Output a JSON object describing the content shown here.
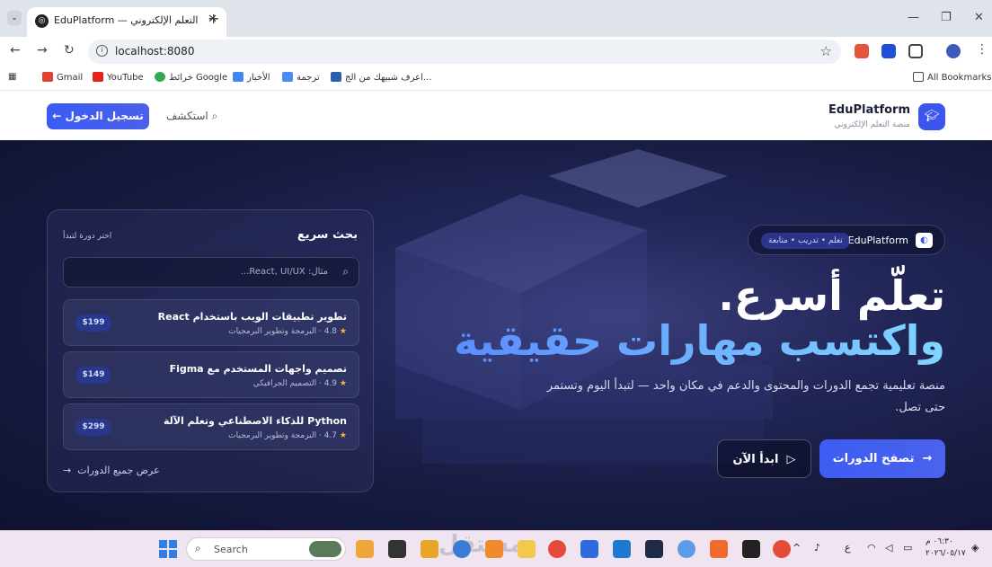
{
  "browser": {
    "tab_title": "EduPlatform — التعلم الإلكتروني",
    "url": "localhost:8080",
    "bookmarks": [
      "Gmail",
      "YouTube",
      "خرائط Google",
      "الأخبار",
      "ترجمة",
      "اعرف شبيهك من الج..."
    ],
    "all_bookmarks": "All Bookmarks"
  },
  "header": {
    "brand_name": "EduPlatform",
    "brand_sub": "منصة التعلم الإلكتروني",
    "explore": "استكشف",
    "login": "تسجيل الدخول"
  },
  "hero": {
    "badge_name": "EduPlatform",
    "badge_tag": "تعلم • تدريب • متابعة",
    "headline1": "تعلّم أسرع.",
    "headline2": "واكتسب مهارات حقيقية",
    "description": "منصة تعليمية تجمع الدورات والمحتوى والدعم في مكان واحد — لتبدأ اليوم وتستمر حتى تصل.",
    "browse_btn": "تصفح الدورات",
    "start_btn": "ابدأ الآن"
  },
  "search_card": {
    "title": "بحث سريع",
    "subtitle": "اختر دورة لتبدأ",
    "placeholder": "مثال: React, UI/UX...",
    "courses": [
      {
        "title": "تطوير تطبيقات الويب باستخدام React",
        "rating": "4.8",
        "category": "البرمجة وتطوير البرمجيات",
        "price": "$199"
      },
      {
        "title": "تصميم واجهات المستخدم مع Figma",
        "rating": "4.9",
        "category": "التصميم الجرافيكي",
        "price": "$149"
      },
      {
        "title": "Python للذكاء الاصطناعي وتعلم الآلة",
        "rating": "4.7",
        "category": "البرمجة وتطوير البرمجيات",
        "price": "$299"
      }
    ],
    "all_courses": "عرض جميع الدورات"
  },
  "taskbar": {
    "search": "Search",
    "time": "٠٦:٣٠ م",
    "date": "٢٠٢٦/٠٥/١٧",
    "lang": "ع",
    "watermark": "مستقل"
  },
  "icons": {
    "tab_menu": "chevron-down-icon",
    "close": "close-icon",
    "star": "star-icon",
    "search": "search-icon",
    "arrow": "arrow-icon",
    "graduation": "graduation-cap-icon"
  }
}
